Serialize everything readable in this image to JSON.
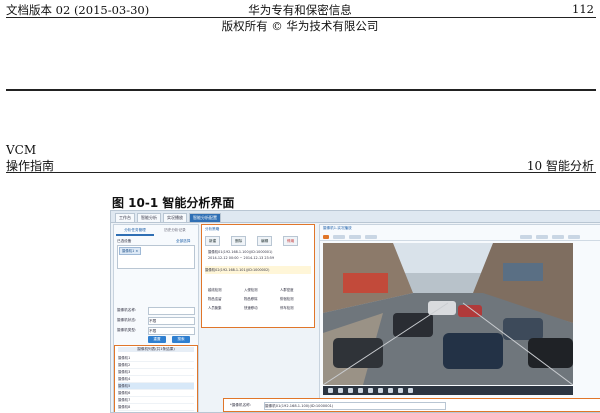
{
  "header": {
    "doc_version": "文档版本 02 (2015-03-30)",
    "center_line1": "华为专有和保密信息",
    "center_line2": "版权所有 © 华为技术有限公司",
    "page_number": "112"
  },
  "section": {
    "product": "VCM",
    "guide": "操作指南",
    "chapter": "10 智能分析"
  },
  "figure": {
    "caption": "图 10-1 智能分析界面"
  },
  "screenshot": {
    "tabs": [
      "工作台",
      "智能分析",
      "实况播放",
      "智能分析配置"
    ],
    "left_panel": {
      "tab_active": "分析任务管理",
      "tab_other": "历史分析记录",
      "query_label": "已选设备",
      "query_btn": "全部选择",
      "chip": "摄像机1 ×",
      "field1_label": "摄像机名称:",
      "field2_label": "摄像机状态:",
      "field2_value": "不限",
      "field3_label": "摄像机类型:",
      "field3_value": "不限",
      "btn_reset": "重置",
      "btn_search": "搜索",
      "list_header": "摄像机列表(共1条结果)",
      "list_items": [
        "摄像机1",
        "摄像机2",
        "摄像机3",
        "摄像机4",
        "摄像机5",
        "摄像机6",
        "摄像机7",
        "摄像机8"
      ]
    },
    "middle_panel": {
      "title": "分析策略",
      "buttons": [
        "新建",
        "删除",
        "编辑",
        "停用"
      ],
      "rows": [
        "摄像机01(192.168.1.100)(ID:1000001)",
        "2014-12-12 00:00 ~ 2014-12-13 23:59",
        "摄像机02(192.168.1.101)(ID:1000002)"
      ],
      "checks": [
        "越线检测",
        "入侵检测",
        "人群密度",
        "物品遗留",
        "物品移除",
        "徘徊检测",
        "人员聚集",
        "快速移动",
        "停车检测"
      ]
    },
    "right_panel": {
      "title": "摄像机1-实况播放",
      "bottom_label": "*摄像机名称:",
      "bottom_value": "摄像机01(192.168.1.100)(ID:1000001)"
    }
  }
}
